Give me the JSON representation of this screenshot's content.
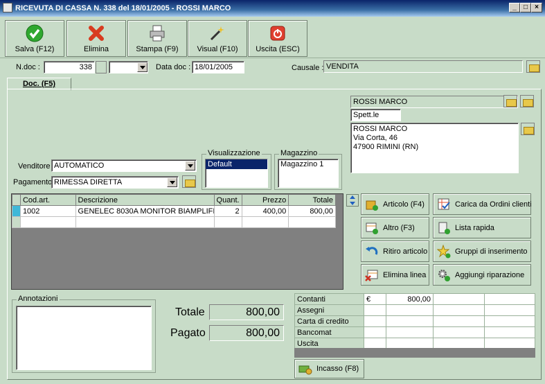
{
  "window": {
    "title": "RICEVUTA DI CASSA N. 338  del 18/01/2005 - ROSSI MARCO"
  },
  "toolbar": {
    "buttons": [
      {
        "label": "Salva (F12)",
        "icon": "check-icon"
      },
      {
        "label": "Elimina",
        "icon": "x-icon"
      },
      {
        "label": "Stampa (F9)",
        "icon": "printer-icon"
      },
      {
        "label": "Visual (F10)",
        "icon": "magic-wand-icon"
      },
      {
        "label": "Uscita (ESC)",
        "icon": "power-icon"
      }
    ]
  },
  "header": {
    "ndoc_label": "N.doc :",
    "ndoc_value": "338",
    "datadoc_label": "Data doc :",
    "datadoc_value": "18/01/2005",
    "causale_label": "Causale :",
    "causale_value": "VENDITA"
  },
  "tab": {
    "label": "Doc. (F5)"
  },
  "customer": {
    "name": "ROSSI MARCO",
    "salutation": "Spett.le",
    "address_lines": [
      "ROSSI MARCO",
      "Via Corta, 46",
      "47900 RIMINI (RN)"
    ]
  },
  "form": {
    "venditore_label": "Venditore",
    "venditore_value": "AUTOMATICO",
    "pagamento_label": "Pagamento",
    "pagamento_value": "RIMESSA DIRETTA",
    "visualizzazione_label": "Visualizzazione",
    "visualizzazione_item": "Default",
    "magazzino_label": "Magazzino",
    "magazzino_item": "Magazzino 1"
  },
  "grid": {
    "headers": [
      "Cod.art.",
      "Descrizione",
      "Quant.",
      "Prezzo",
      "Totale"
    ],
    "rows": [
      [
        "1002",
        "GENELEC 8030A MONITOR BIAMPLIFI",
        "2",
        "400,00",
        "800,00"
      ]
    ]
  },
  "actions": [
    {
      "label": "Articolo (F4)",
      "icon": "box-add-icon"
    },
    {
      "label": "Carica da Ordini clienti",
      "icon": "grid-check-icon"
    },
    {
      "label": "Altro (F3)",
      "icon": "table-add-icon"
    },
    {
      "label": "Lista rapida",
      "icon": "list-add-icon"
    },
    {
      "label": "Ritiro articolo",
      "icon": "return-arrow-icon"
    },
    {
      "label": "Gruppi di inserimento",
      "icon": "star-add-icon"
    },
    {
      "label": "Elimina linea",
      "icon": "table-remove-icon"
    },
    {
      "label": "Aggiungi riparazione",
      "icon": "gears-icon"
    }
  ],
  "notes": {
    "label": "Annotazioni",
    "value": ""
  },
  "totals": {
    "totale_label": "Totale",
    "totale_value": "800,00",
    "pagato_label": "Pagato",
    "pagato_value": "800,00"
  },
  "payments": {
    "rows": [
      {
        "label": "Contanti",
        "currency": "€",
        "amount": "800,00"
      },
      {
        "label": "Assegni",
        "currency": "",
        "amount": ""
      },
      {
        "label": "Carta di credito",
        "currency": "",
        "amount": ""
      },
      {
        "label": "Bancomat",
        "currency": "",
        "amount": ""
      },
      {
        "label": "Uscita",
        "currency": "",
        "amount": ""
      }
    ]
  },
  "incasso": {
    "label": "Incasso (F8)"
  }
}
